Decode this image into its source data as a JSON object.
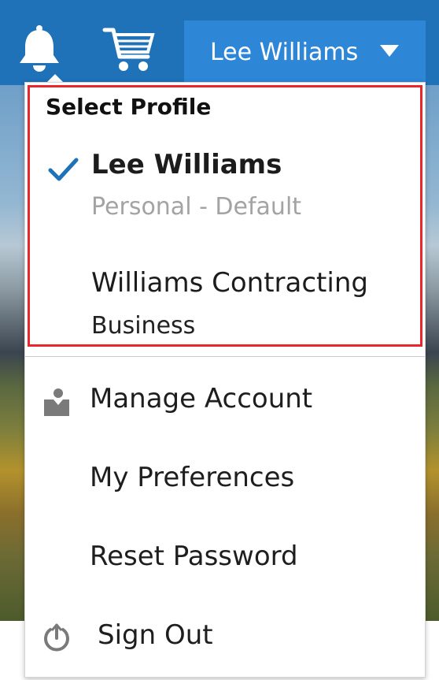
{
  "header": {
    "bell_icon": "bell-icon",
    "cart_icon": "shopping-cart-icon",
    "user_name": "Lee Williams",
    "caret_icon": "caret-down-icon"
  },
  "colors": {
    "header_bg": "#1f71b8",
    "user_button_bg": "#2e86d6",
    "highlight_border": "#e8262b",
    "check_color": "#1f71b8"
  },
  "dropdown": {
    "section_title": "Select Profile",
    "profiles": [
      {
        "name": "Lee Williams",
        "subtitle": "Personal - Default",
        "selected": true
      },
      {
        "name": "Williams Contracting",
        "subtitle": "Business",
        "selected": false
      }
    ],
    "menu": [
      {
        "label": "Manage Account",
        "icon": "person-icon"
      },
      {
        "label": "My Preferences",
        "icon": ""
      },
      {
        "label": "Reset Password",
        "icon": ""
      },
      {
        "label": "Sign Out",
        "icon": "power-icon"
      }
    ]
  }
}
